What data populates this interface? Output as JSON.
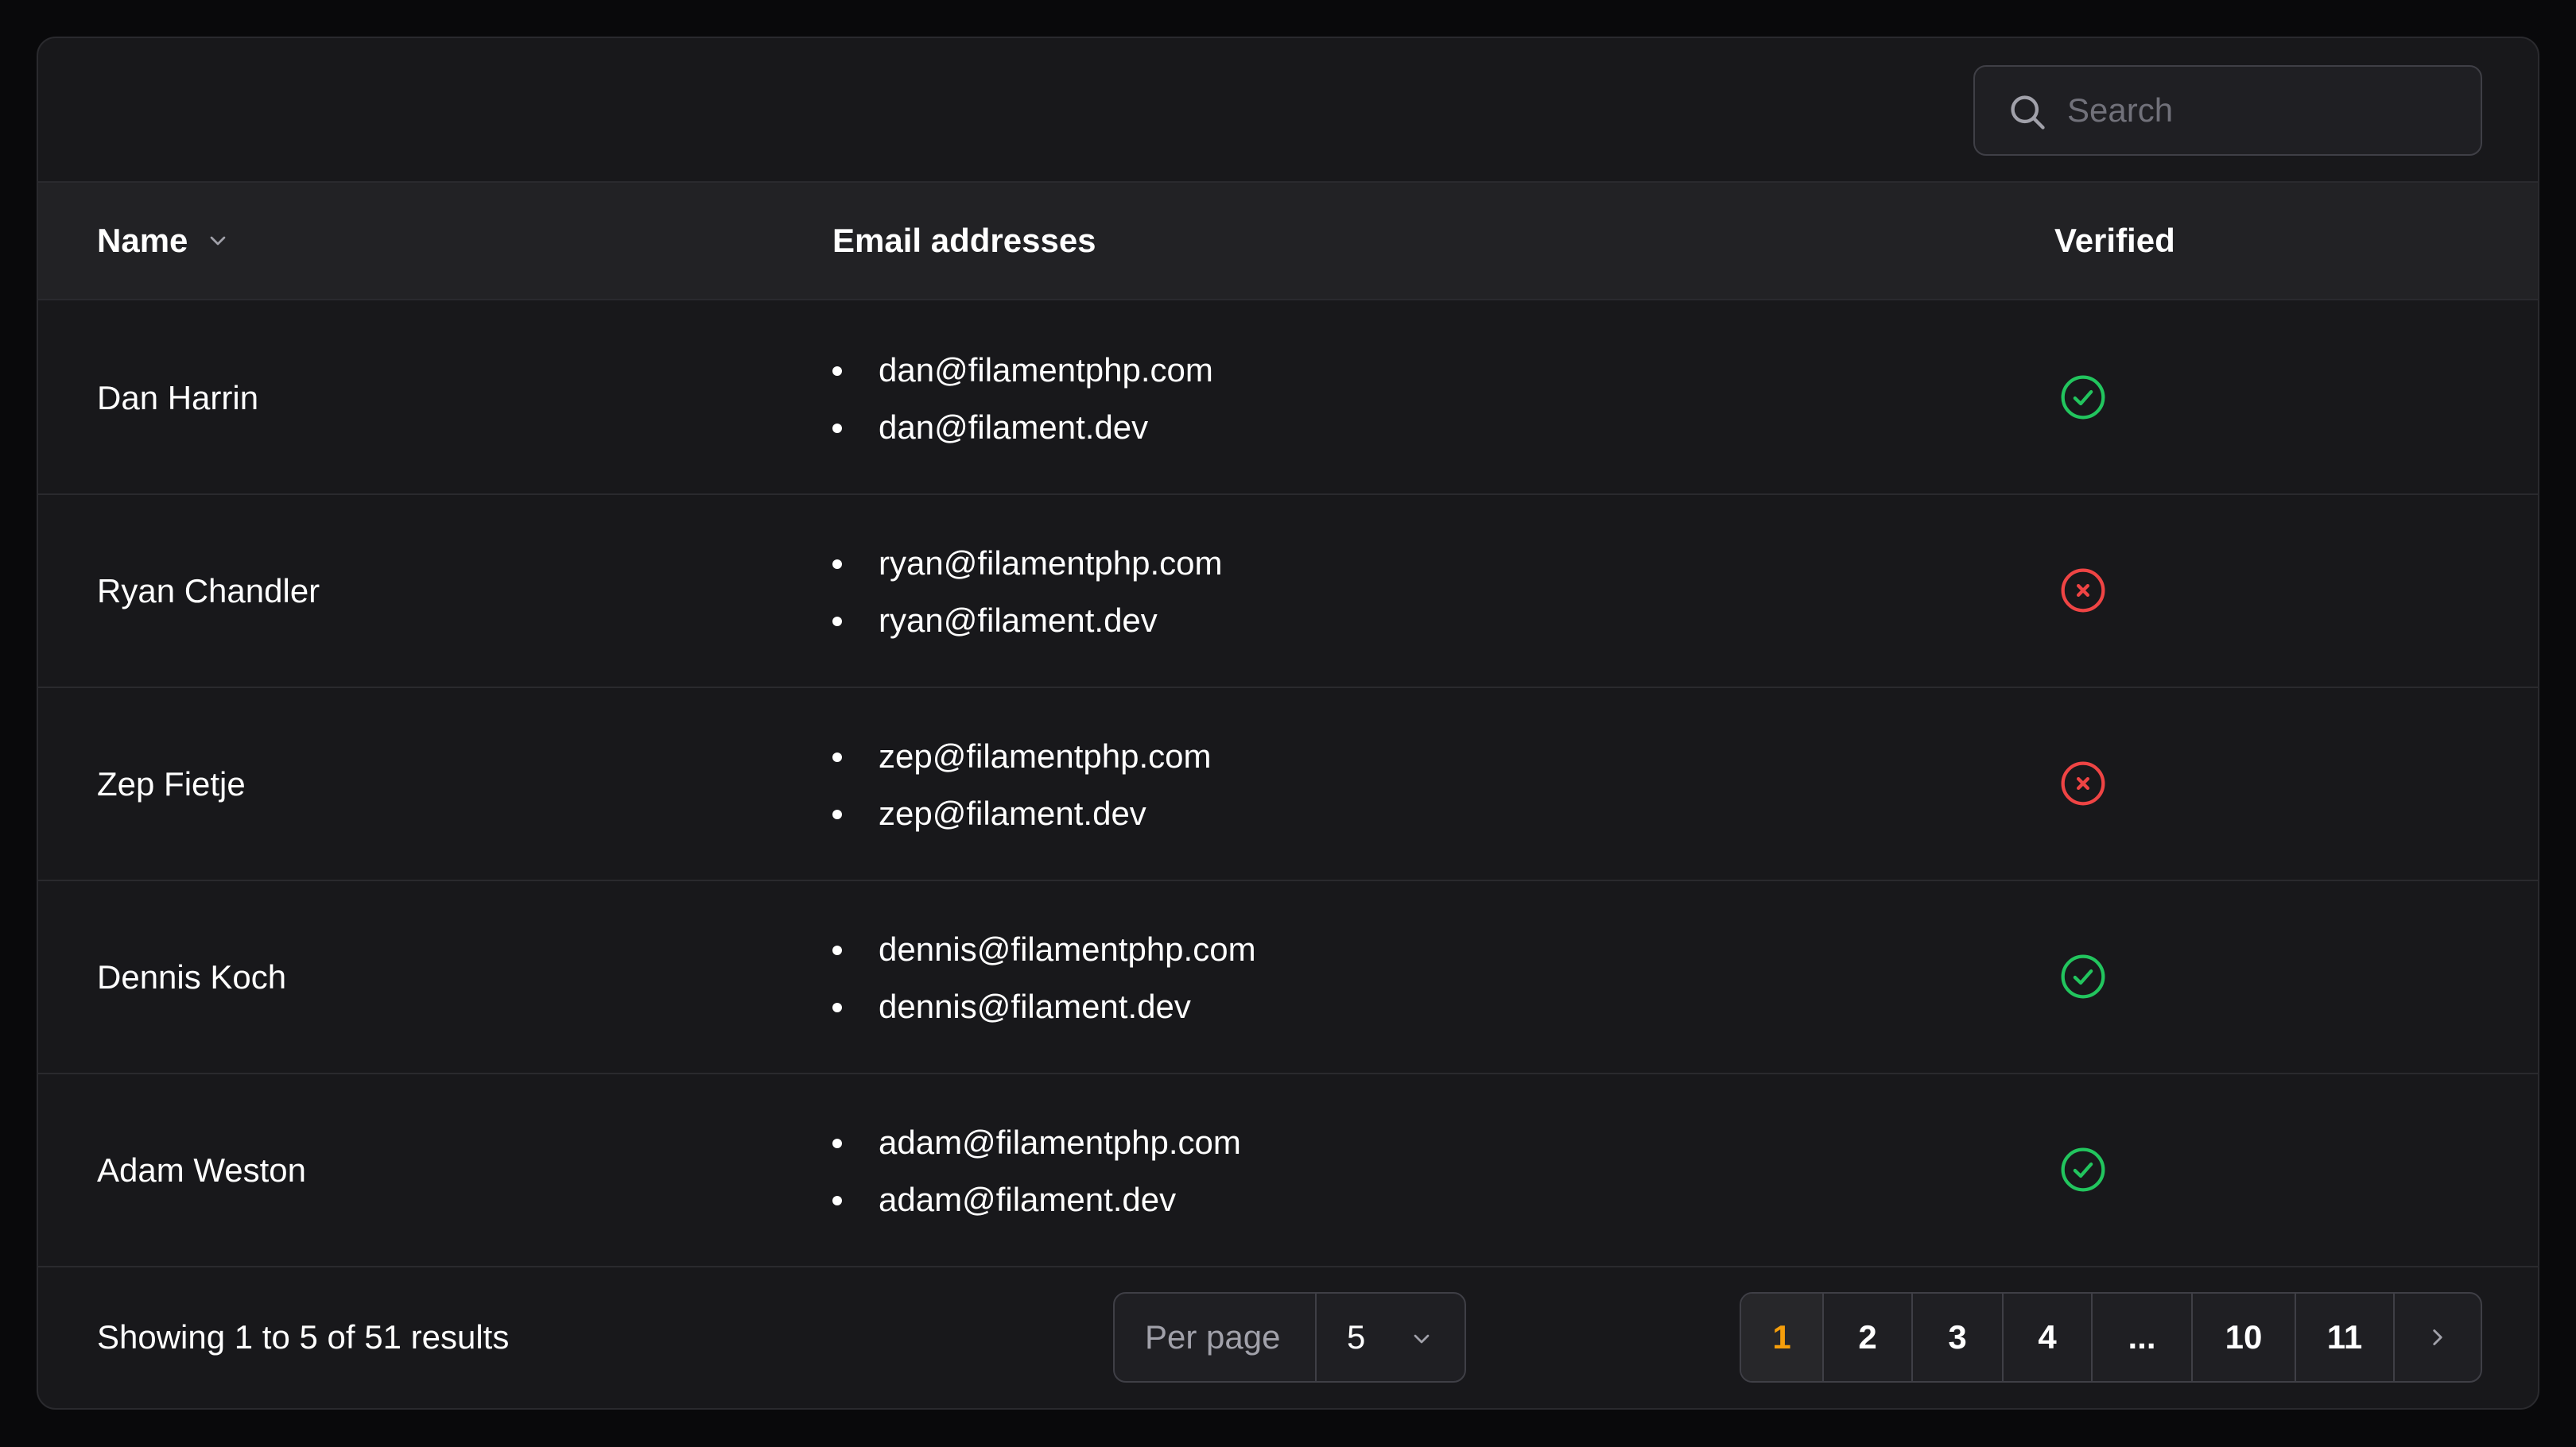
{
  "search": {
    "placeholder": "Search"
  },
  "table": {
    "columns": {
      "name": "Name",
      "email": "Email addresses",
      "verified": "Verified"
    },
    "rows": [
      {
        "name": "Dan Harrin",
        "emails": [
          "dan@filamentphp.com",
          "dan@filament.dev"
        ],
        "verified": true
      },
      {
        "name": "Ryan Chandler",
        "emails": [
          "ryan@filamentphp.com",
          "ryan@filament.dev"
        ],
        "verified": false
      },
      {
        "name": "Zep Fietje",
        "emails": [
          "zep@filamentphp.com",
          "zep@filament.dev"
        ],
        "verified": false
      },
      {
        "name": "Dennis Koch",
        "emails": [
          "dennis@filamentphp.com",
          "dennis@filament.dev"
        ],
        "verified": true
      },
      {
        "name": "Adam Weston",
        "emails": [
          "adam@filamentphp.com",
          "adam@filament.dev"
        ],
        "verified": true
      }
    ]
  },
  "footer": {
    "showing": "Showing 1 to 5 of 51 results",
    "per_page_label": "Per page",
    "per_page_value": "5",
    "pages": [
      "1",
      "2",
      "3",
      "4",
      "...",
      "10",
      "11"
    ],
    "active_page": "1"
  },
  "colors": {
    "verified_true": "#22c55e",
    "verified_false": "#ef4444",
    "active_page": "#f59e0b"
  },
  "icons": {
    "search": "search-icon",
    "sort": "chevron-down-icon",
    "verified_true": "check-circle-icon",
    "verified_false": "x-circle-icon",
    "next": "chevron-right-icon"
  }
}
